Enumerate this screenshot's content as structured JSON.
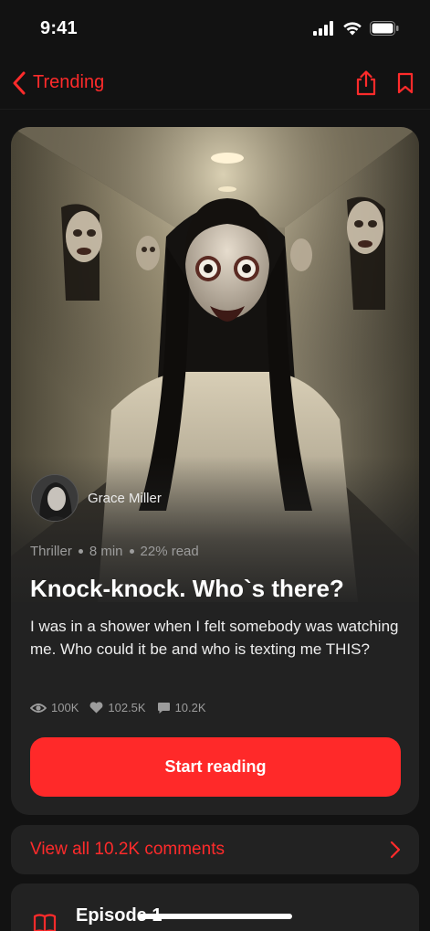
{
  "status_bar": {
    "time": "9:41"
  },
  "nav": {
    "back_label": "Trending"
  },
  "author": {
    "name": "Grace Miller"
  },
  "story": {
    "genre": "Thriller",
    "duration": "8 min",
    "progress": "22% read",
    "title": "Knock-knock. Who`s there?",
    "description": "I was in a shower when I felt somebody was watching me. Who could it be and who is texting me THIS?",
    "stats": {
      "views": "100K",
      "likes": "102.5K",
      "comments": "10.2K"
    },
    "cta_label": "Start reading"
  },
  "comments": {
    "label": "View all 10.2K comments"
  },
  "episode": {
    "title": "Episode 1"
  },
  "colors": {
    "accent": "#ff2929",
    "card": "#222222",
    "background": "#121212"
  }
}
